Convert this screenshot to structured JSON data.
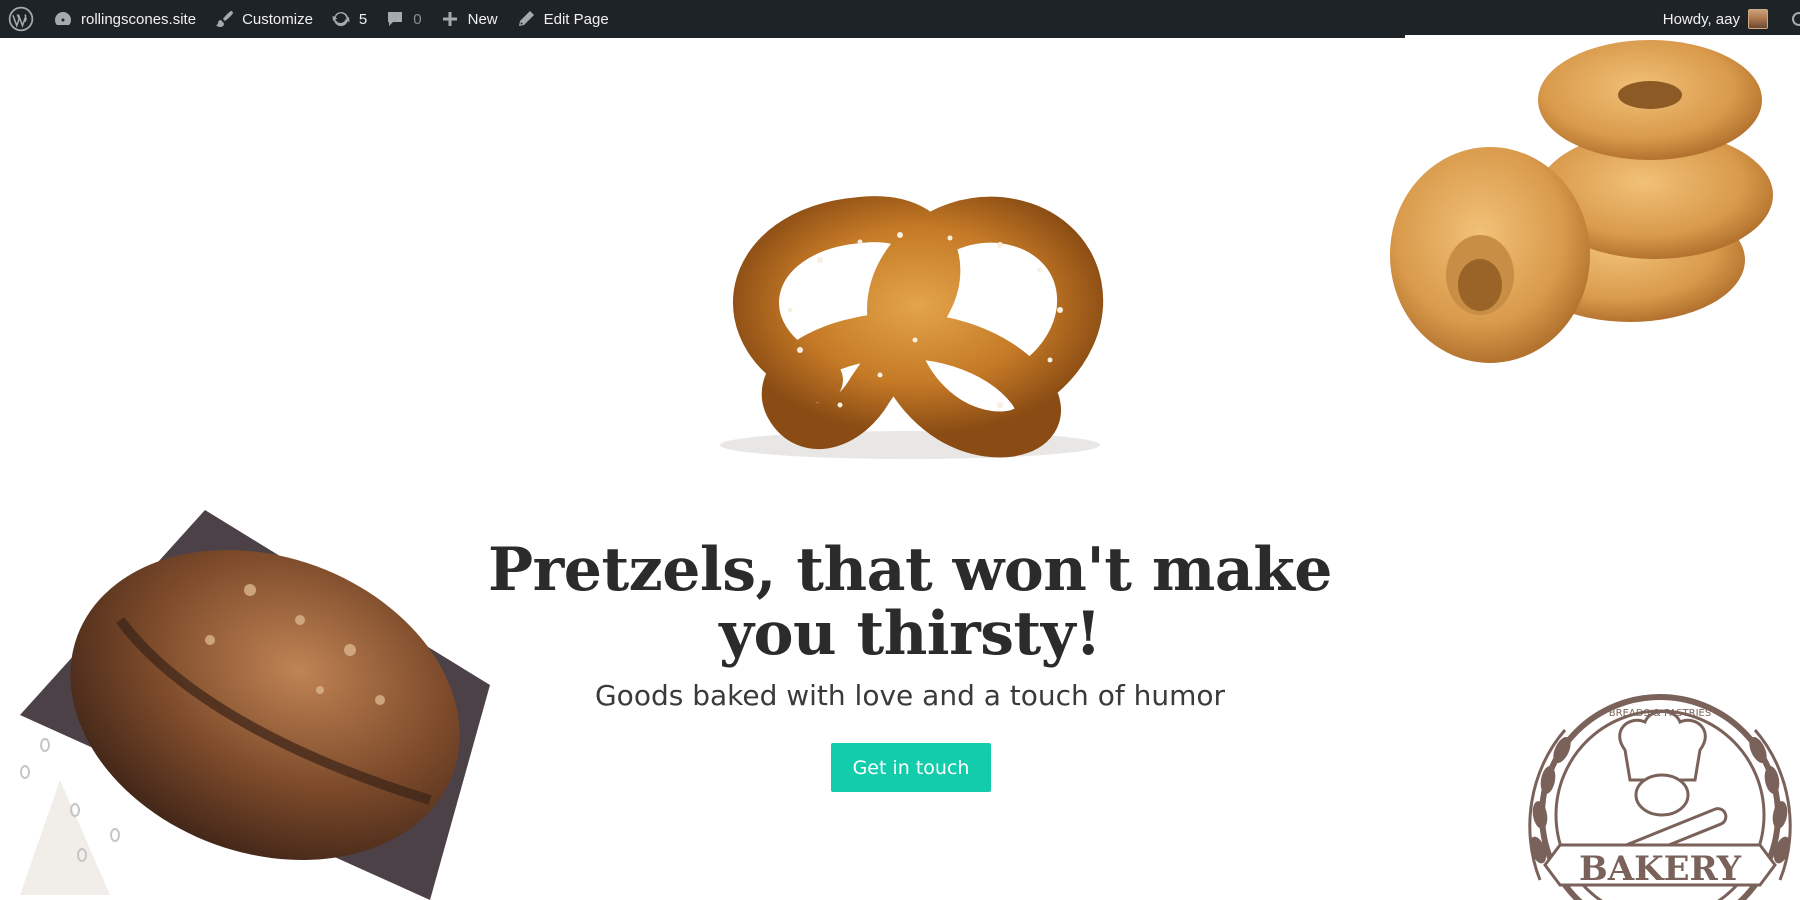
{
  "admin_bar": {
    "site_name": "rollingscones.site",
    "customize_label": "Customize",
    "updates_count": "5",
    "comments_count": "0",
    "new_label": "New",
    "edit_page_label": "Edit Page",
    "greeting": "Howdy, aay",
    "icons": {
      "wordpress": "wordpress-logo-icon",
      "site": "dashboard-gauge-icon",
      "customize": "brush-icon",
      "updates": "refresh-icon",
      "comments": "comment-bubble-icon",
      "new": "plus-icon",
      "edit": "pencil-icon"
    }
  },
  "hero": {
    "headline": "Pretzels, that won't make you thirsty!",
    "subheadline": "Goods baked with love and a touch of humor",
    "cta_label": "Get in touch",
    "cta_color": "#12ccab",
    "logo_top_text": "BREADS & PASTRIES",
    "logo_banner_text": "BAKERY"
  },
  "colors": {
    "admin_bar_bg": "#1d2327",
    "headline": "#2b2b2b",
    "page_bg": "#ffffff"
  }
}
